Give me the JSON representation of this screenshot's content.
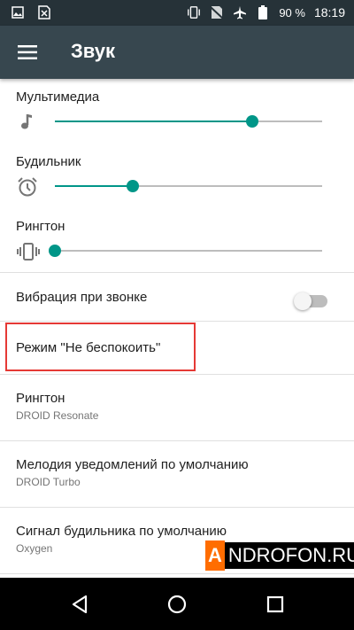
{
  "status_bar": {
    "icons": [
      "image-icon",
      "sim-icon",
      "vibrate-icon",
      "no-sim-icon",
      "airplane-icon",
      "battery-icon"
    ],
    "battery_percent": "90 %",
    "time": "18:19"
  },
  "app_bar": {
    "title": "Звук"
  },
  "volumes": [
    {
      "label": "Мультимедиа",
      "icon": "music-note-icon",
      "level": 0.74
    },
    {
      "label": "Будильник",
      "icon": "alarm-icon",
      "level": 0.29
    },
    {
      "label": "Рингтон",
      "icon": "vibrate-icon",
      "level": 0.0
    }
  ],
  "vibration": {
    "label": "Вибрация при звонке",
    "enabled": false
  },
  "dnd": {
    "label": "Режим \"Не беспокоить\""
  },
  "ringtone": {
    "title": "Рингтон",
    "value": "DROID Resonate"
  },
  "notification_sound": {
    "title": "Мелодия уведомлений по умолчанию",
    "value": "DROID Turbo"
  },
  "alarm_sound": {
    "title": "Сигнал будильника по умолчанию",
    "value": "Oxygen"
  },
  "watermark": {
    "first": "A",
    "rest": "NDROFON.RU"
  },
  "colors": {
    "accent": "#009688",
    "app_bar": "#37474f",
    "status_bar": "#263238",
    "highlight": "#e53935"
  }
}
